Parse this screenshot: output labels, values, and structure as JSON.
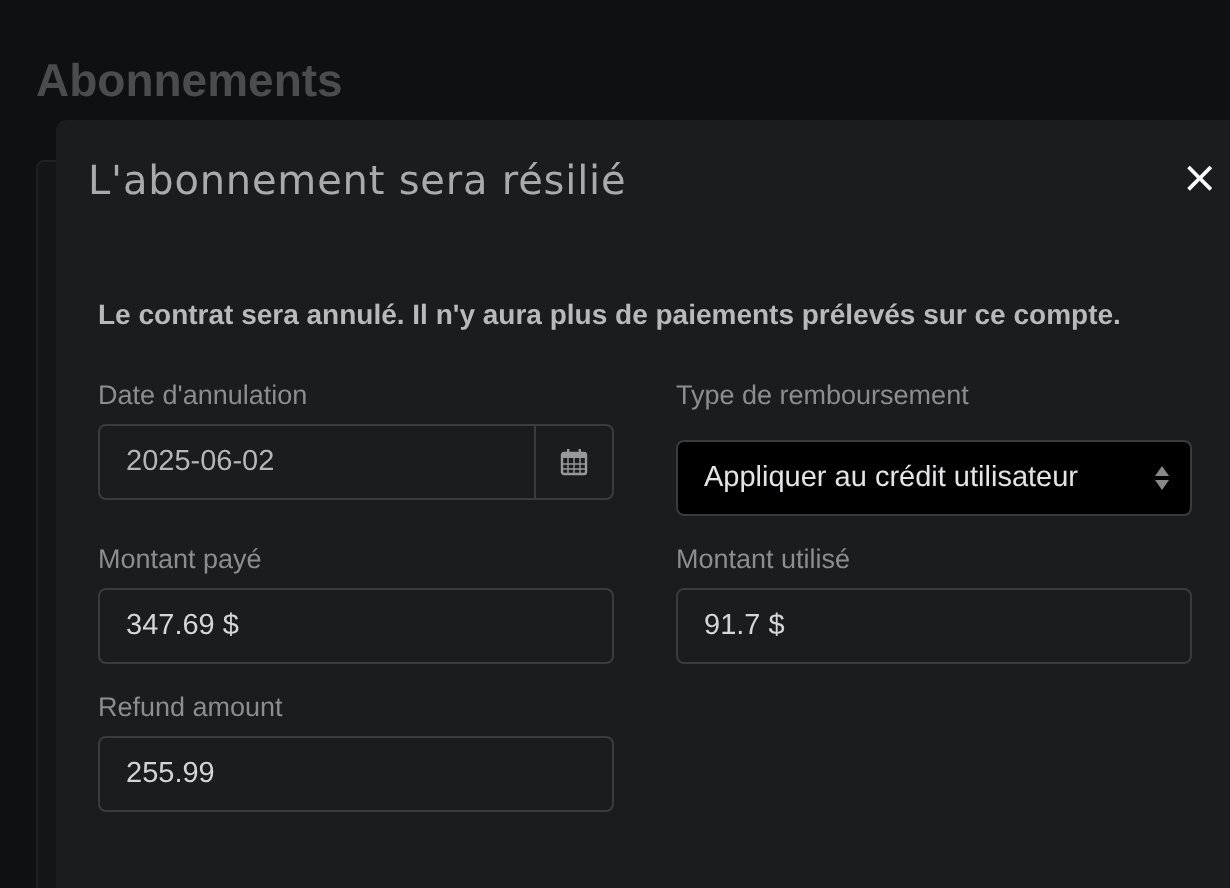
{
  "page": {
    "title": "Abonnements"
  },
  "dialog": {
    "title": "L'abonnement sera résilié",
    "close": "×",
    "message": "Le contrat sera annulé. Il n'y aura plus de paiements prélevés sur ce compte.",
    "fields": [
      {
        "kind": "date",
        "label": "Date d'annulation",
        "value": "2025-06-02"
      },
      {
        "kind": "select",
        "label": "Type de remboursement",
        "value": "Appliquer au crédit utilisateur"
      },
      {
        "kind": "text",
        "label": "Montant payé",
        "value": "347.69 $"
      },
      {
        "kind": "text",
        "label": "Montant utilisé",
        "value": "91.7 $"
      },
      {
        "kind": "text",
        "label": "Refund amount",
        "value": "255.99"
      }
    ]
  }
}
